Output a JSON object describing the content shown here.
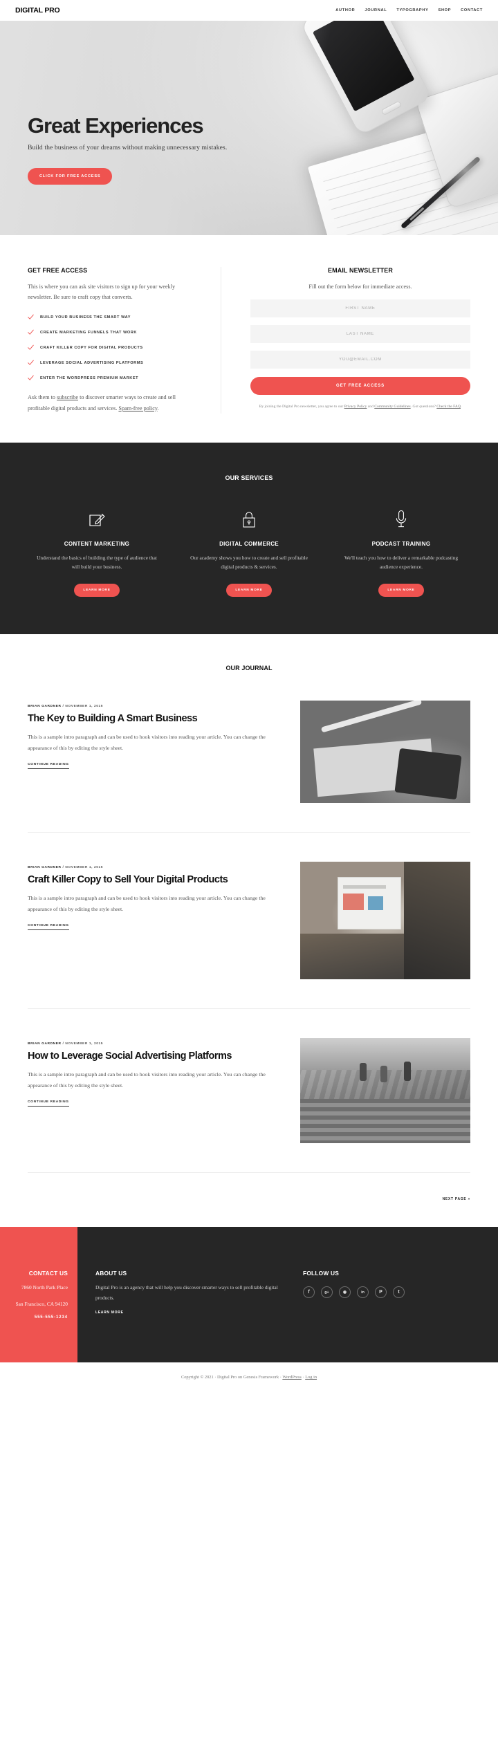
{
  "header": {
    "logo": "DIGITAL PRO",
    "nav": [
      {
        "label": "AUTHOR"
      },
      {
        "label": "JOURNAL"
      },
      {
        "label": "TYPOGRAPHY"
      },
      {
        "label": "SHOP"
      },
      {
        "label": "CONTACT"
      }
    ]
  },
  "hero": {
    "title": "Great Experiences",
    "subtitle": "Build the business of your dreams without making unnecessary mistakes.",
    "cta": "CLICK FOR FREE ACCESS"
  },
  "optin": {
    "left": {
      "title": "GET FREE ACCESS",
      "text": "This is where you can ask site visitors to sign up for your weekly newsletter. Be sure to craft copy that converts.",
      "benefits": [
        "BUILD YOUR BUSINESS THE SMART WAY",
        "CREATE MARKETING FUNNELS THAT WORK",
        "CRAFT KILLER COPY FOR DIGITAL PRODUCTS",
        "LEVERAGE SOCIAL ADVERTISING PLATFORMS",
        "ENTER THE WORDPRESS PREMIUM MARKET"
      ],
      "footer_pre": "Ask them to ",
      "footer_link1": "subscribe",
      "footer_mid": " to discover smarter ways to create and sell profitable digital products and services. ",
      "footer_link2": "Spam-free policy",
      "footer_end": "."
    },
    "right": {
      "title": "EMAIL NEWSLETTER",
      "text": "Fill out the form below for immediate access.",
      "first_name_placeholder": "FIRST NAME",
      "last_name_placeholder": "LAST NAME",
      "email_placeholder": "YOU@EMAIL.COM",
      "first_name_value": "",
      "last_name_value": "",
      "email_value": "",
      "submit": "GET FREE ACCESS",
      "legal_pre": "By joining the Digital Pro newsletter, you agree to our ",
      "legal_link1": "Privacy Policy",
      "legal_mid": " and ",
      "legal_link2": "Community Guidelines",
      "legal_mid2": ". Got questions? ",
      "legal_link3": "Check the FAQ",
      "legal_end": "."
    }
  },
  "services": {
    "title": "OUR SERVICES",
    "items": [
      {
        "icon": "pencil-square-icon",
        "name": "CONTENT MARKETING",
        "desc": "Understand the basics of building the type of audience that will build your business.",
        "cta": "LEARN MORE"
      },
      {
        "icon": "lock-icon",
        "name": "DIGITAL COMMERCE",
        "desc": "Our academy shows you how to create and sell profitable digital products & services.",
        "cta": "LEARN MORE"
      },
      {
        "icon": "microphone-icon",
        "name": "PODCAST TRAINING",
        "desc": "We'll teach you how to deliver a remarkable podcasting audience experience.",
        "cta": "LEARN MORE"
      }
    ]
  },
  "journal": {
    "title": "OUR JOURNAL",
    "posts": [
      {
        "author": "BRIAN GARDNER",
        "sep": " / ",
        "date": "NOVEMBER 1, 2015",
        "title": "The Key to Building A Smart Business",
        "excerpt": "This is a sample intro paragraph and can be used to hook visitors into reading your article. You can change the appearance of this by editing the style sheet.",
        "more": "CONTINUE READING",
        "image": "desk-notebook-pen-photo"
      },
      {
        "author": "BRIAN GARDNER",
        "sep": " / ",
        "date": "NOVEMBER 1, 2015",
        "title": "Craft Killer Copy to Sell Your Digital Products",
        "excerpt": "This is a sample intro paragraph and can be used to hook visitors into reading your article. You can change the appearance of this by editing the style sheet.",
        "more": "CONTINUE READING",
        "image": "person-holding-tablet-photo"
      },
      {
        "author": "BRIAN GARDNER",
        "sep": " / ",
        "date": "NOVEMBER 1, 2015",
        "title": "How to Leverage Social Advertising Platforms",
        "excerpt": "This is a sample intro paragraph and can be used to hook visitors into reading your article. You can change the appearance of this by editing the style sheet.",
        "more": "CONTINUE READING",
        "image": "crowd-stairs-photo"
      }
    ],
    "next_page": "NEXT PAGE »"
  },
  "footer": {
    "contact": {
      "title": "CONTACT US",
      "address1": "7860 North Park Place",
      "address2": "San Francisco, CA 94120",
      "phone": "555-555-1234"
    },
    "about": {
      "title": "ABOUT US",
      "text": "Digital Pro is an agency that will help you discover smarter ways to sell profitable digital products.",
      "cta": "LEARN MORE"
    },
    "follow": {
      "title": "FOLLOW US",
      "socials": [
        {
          "icon": "facebook-icon",
          "glyph": "f"
        },
        {
          "icon": "google-plus-icon",
          "glyph": "g+"
        },
        {
          "icon": "instagram-icon",
          "glyph": "◉"
        },
        {
          "icon": "linkedin-icon",
          "glyph": "in"
        },
        {
          "icon": "pinterest-icon",
          "glyph": "P"
        },
        {
          "icon": "twitter-icon",
          "glyph": "t"
        }
      ]
    }
  },
  "credit": {
    "pre": "Copyright © 2021 · Digital Pro on Genesis Framework · ",
    "link1": "WordPress",
    "mid": " · ",
    "link2": "Log in"
  },
  "colors": {
    "accent": "#ef5350",
    "dark": "#262626",
    "text": "#333333"
  }
}
